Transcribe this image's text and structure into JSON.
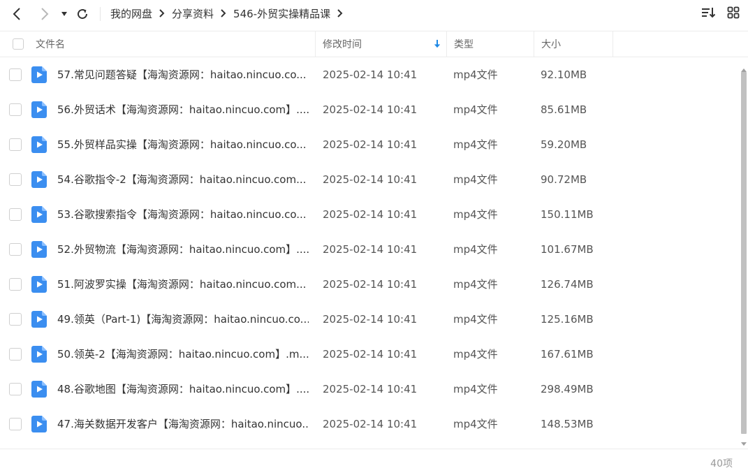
{
  "breadcrumb": {
    "items": [
      "我的网盘",
      "分享资料",
      "546-外贸实操精品课"
    ]
  },
  "header": {
    "name": "文件名",
    "modified": "修改时间",
    "type": "类型",
    "size": "大小"
  },
  "files": [
    {
      "name": "57.常见问题答疑【海淘资源网：haitao.nincuo.co...",
      "modified": "2025-02-14 10:41",
      "type": "mp4文件",
      "size": "92.10MB"
    },
    {
      "name": "56.外贸话术【海淘资源网：haitao.nincuo.com】....",
      "modified": "2025-02-14 10:41",
      "type": "mp4文件",
      "size": "85.61MB"
    },
    {
      "name": "55.外贸样品实操【海淘资源网：haitao.nincuo.co...",
      "modified": "2025-02-14 10:41",
      "type": "mp4文件",
      "size": "59.20MB"
    },
    {
      "name": "54.谷歌指令-2【海淘资源网：haitao.nincuo.com...",
      "modified": "2025-02-14 10:41",
      "type": "mp4文件",
      "size": "90.72MB"
    },
    {
      "name": "53.谷歌搜索指令【海淘资源网：haitao.nincuo.co...",
      "modified": "2025-02-14 10:41",
      "type": "mp4文件",
      "size": "150.11MB"
    },
    {
      "name": "52.外贸物流【海淘资源网：haitao.nincuo.com】....",
      "modified": "2025-02-14 10:41",
      "type": "mp4文件",
      "size": "101.67MB"
    },
    {
      "name": "51.阿波罗实操【海淘资源网：haitao.nincuo.com...",
      "modified": "2025-02-14 10:41",
      "type": "mp4文件",
      "size": "126.74MB"
    },
    {
      "name": "49.领英（Part-1)【海淘资源网：haitao.nincuo.co...",
      "modified": "2025-02-14 10:41",
      "type": "mp4文件",
      "size": "125.16MB"
    },
    {
      "name": "50.领英-2【海淘资源网：haitao.nincuo.com】.m...",
      "modified": "2025-02-14 10:41",
      "type": "mp4文件",
      "size": "167.61MB"
    },
    {
      "name": "48.谷歌地图【海淘资源网：haitao.nincuo.com】....",
      "modified": "2025-02-14 10:41",
      "type": "mp4文件",
      "size": "298.49MB"
    },
    {
      "name": "47.海关数据开发客户【海淘资源网：haitao.nincuo...",
      "modified": "2025-02-14 10:41",
      "type": "mp4文件",
      "size": "148.53MB"
    }
  ],
  "footer": {
    "count": "40项"
  },
  "icons": {
    "back": "back-arrow-icon",
    "forward": "forward-arrow-icon",
    "history": "dropdown-triangle-icon",
    "refresh": "refresh-icon",
    "sort": "sort-icon",
    "grid": "grid-view-icon",
    "file": "video-file-icon",
    "sort_direction": "sort-down-arrow-icon"
  },
  "colors": {
    "accent": "#1e88e5",
    "file_icon": "#3b8ef0"
  }
}
